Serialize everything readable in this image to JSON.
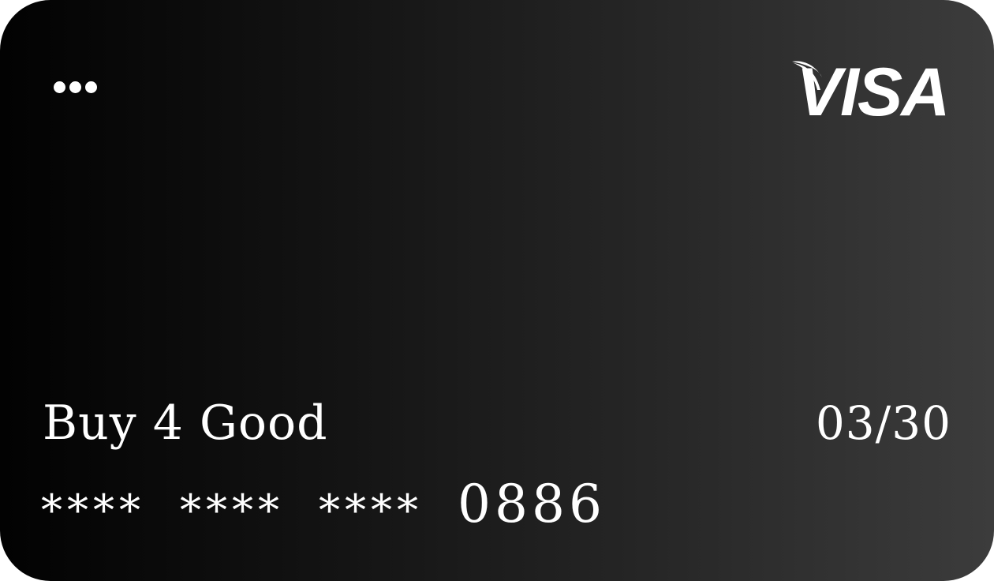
{
  "card": {
    "brand": "VISA",
    "brand_logo_icon": "visa-logo",
    "menu_icon": "ellipsis-icon",
    "name": "Buy 4 Good",
    "expiry": "03/30",
    "number": {
      "masked_groups": [
        "****",
        "****",
        "****"
      ],
      "last4": "0886"
    },
    "colors": {
      "background_start": "#020202",
      "background_end": "#3c3c3c",
      "text": "#ffffff"
    }
  }
}
